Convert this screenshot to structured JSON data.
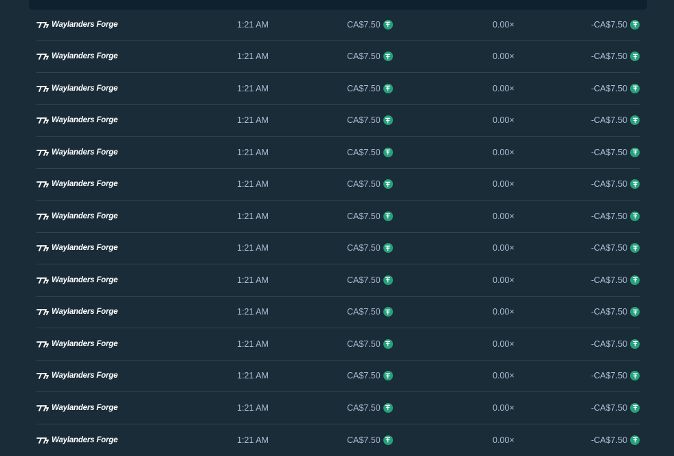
{
  "currency_icon": "tether-coin-icon",
  "game_icon": "stake-originals-icon",
  "accent_color": "#26a17b",
  "rows": [
    {
      "game": "Waylanders Forge",
      "time": "1:21 AM",
      "bet": "CA$7.50",
      "multiplier": "0.00×",
      "payout": "-CA$7.50"
    },
    {
      "game": "Waylanders Forge",
      "time": "1:21 AM",
      "bet": "CA$7.50",
      "multiplier": "0.00×",
      "payout": "-CA$7.50"
    },
    {
      "game": "Waylanders Forge",
      "time": "1:21 AM",
      "bet": "CA$7.50",
      "multiplier": "0.00×",
      "payout": "-CA$7.50"
    },
    {
      "game": "Waylanders Forge",
      "time": "1:21 AM",
      "bet": "CA$7.50",
      "multiplier": "0.00×",
      "payout": "-CA$7.50"
    },
    {
      "game": "Waylanders Forge",
      "time": "1:21 AM",
      "bet": "CA$7.50",
      "multiplier": "0.00×",
      "payout": "-CA$7.50"
    },
    {
      "game": "Waylanders Forge",
      "time": "1:21 AM",
      "bet": "CA$7.50",
      "multiplier": "0.00×",
      "payout": "-CA$7.50"
    },
    {
      "game": "Waylanders Forge",
      "time": "1:21 AM",
      "bet": "CA$7.50",
      "multiplier": "0.00×",
      "payout": "-CA$7.50"
    },
    {
      "game": "Waylanders Forge",
      "time": "1:21 AM",
      "bet": "CA$7.50",
      "multiplier": "0.00×",
      "payout": "-CA$7.50"
    },
    {
      "game": "Waylanders Forge",
      "time": "1:21 AM",
      "bet": "CA$7.50",
      "multiplier": "0.00×",
      "payout": "-CA$7.50"
    },
    {
      "game": "Waylanders Forge",
      "time": "1:21 AM",
      "bet": "CA$7.50",
      "multiplier": "0.00×",
      "payout": "-CA$7.50"
    },
    {
      "game": "Waylanders Forge",
      "time": "1:21 AM",
      "bet": "CA$7.50",
      "multiplier": "0.00×",
      "payout": "-CA$7.50"
    },
    {
      "game": "Waylanders Forge",
      "time": "1:21 AM",
      "bet": "CA$7.50",
      "multiplier": "0.00×",
      "payout": "-CA$7.50"
    },
    {
      "game": "Waylanders Forge",
      "time": "1:21 AM",
      "bet": "CA$7.50",
      "multiplier": "0.00×",
      "payout": "-CA$7.50"
    },
    {
      "game": "Waylanders Forge",
      "time": "1:21 AM",
      "bet": "CA$7.50",
      "multiplier": "0.00×",
      "payout": "-CA$7.50"
    }
  ]
}
